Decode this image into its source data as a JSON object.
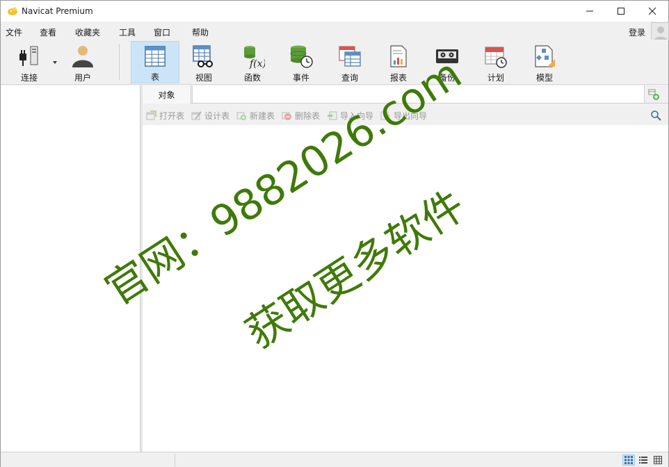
{
  "window": {
    "title": "Navicat Premium"
  },
  "menu": {
    "items": [
      "文件",
      "查看",
      "收藏夹",
      "工具",
      "窗口",
      "帮助"
    ],
    "login": "登录"
  },
  "toolbar": {
    "connect": "连接",
    "user": "用户",
    "table": "表",
    "view": "视图",
    "function": "函数",
    "event": "事件",
    "query": "查询",
    "report": "报表",
    "backup": "备份",
    "schedule": "计划",
    "model": "模型"
  },
  "tabs": {
    "object": "对象"
  },
  "object_toolbar": {
    "open_table": "打开表",
    "design_table": "设计表",
    "new_table": "新建表",
    "delete_table": "删除表",
    "import_wizard": "导入向导",
    "export_wizard": "导出向导"
  },
  "watermark": {
    "line1": "官网：9882026.com",
    "line2": "获取更多软件"
  },
  "colors": {
    "accent": "#cce4f7",
    "watermark": "#3f7a09",
    "disabled_text": "#9a9a9a"
  }
}
